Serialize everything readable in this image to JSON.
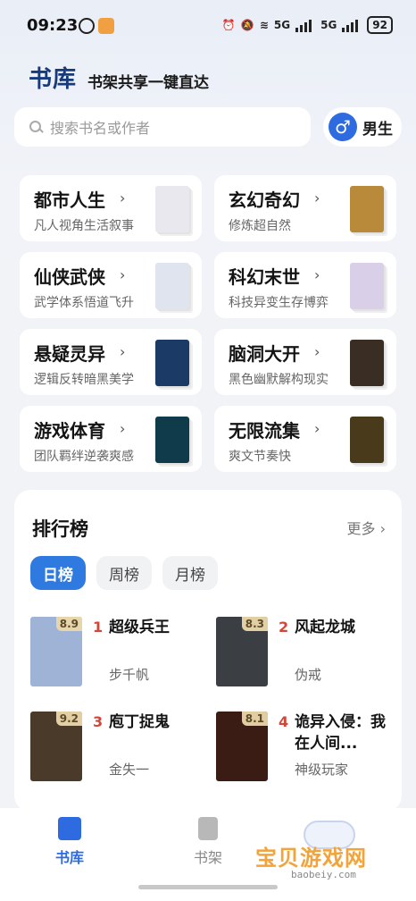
{
  "status_bar": {
    "time": "09:23",
    "net1": "5G",
    "net2": "5G",
    "battery": "92"
  },
  "header": {
    "title": "书库",
    "subtitle": "书架共享一键直达"
  },
  "search": {
    "placeholder": "搜索书名或作者"
  },
  "gender": {
    "icon": "male-symbol-icon",
    "label": "男生"
  },
  "categories": [
    {
      "name": "都市人生",
      "desc": "凡人视角生活叙事",
      "cover_color": "#e8e8ee"
    },
    {
      "name": "玄幻奇幻",
      "desc": "修炼超自然",
      "cover_color": "#b88a3a"
    },
    {
      "name": "仙侠武侠",
      "desc": "武学体系悟道飞升",
      "cover_color": "#dfe4ee"
    },
    {
      "name": "科幻末世",
      "desc": "科技异变生存博弈",
      "cover_color": "#d9cfe8"
    },
    {
      "name": "悬疑灵异",
      "desc": "逻辑反转暗黑美学",
      "cover_color": "#1b3a66"
    },
    {
      "name": "脑洞大开",
      "desc": "黑色幽默解构现实",
      "cover_color": "#3a2e24"
    },
    {
      "name": "游戏体育",
      "desc": "团队羁绊逆袭爽感",
      "cover_color": "#0f3b4a"
    },
    {
      "name": "无限流集",
      "desc": "爽文节奏快",
      "cover_color": "#4a3a1c"
    }
  ],
  "ranking": {
    "title": "排行榜",
    "more": "更多",
    "tabs": [
      "日榜",
      "周榜",
      "月榜"
    ],
    "active_tab": "日榜",
    "books": [
      {
        "rank": "1",
        "title": "超级兵王",
        "author": "步千帆",
        "score": "8.9",
        "cover_color": "#9fb3d6"
      },
      {
        "rank": "2",
        "title": "风起龙城",
        "author": "伪戒",
        "score": "8.3",
        "cover_color": "#3b3f44"
      },
      {
        "rank": "3",
        "title": "庖丁捉鬼",
        "author": "金失一",
        "score": "9.2",
        "cover_color": "#4a3a2a"
      },
      {
        "rank": "4",
        "title": "诡异入侵：我在人间...",
        "author": "神级玩家",
        "score": "8.1",
        "cover_color": "#3a1c14"
      }
    ]
  },
  "bottom_nav": [
    {
      "label": "书库",
      "icon": "library-book-icon",
      "active": true
    },
    {
      "label": "书架",
      "icon": "bookshelf-icon",
      "active": false
    }
  ],
  "watermark": {
    "logo": "宝贝游戏网",
    "url": "baobeiy.com"
  },
  "colors": {
    "accent": "#2f7ae0",
    "brand_title": "#173a7a",
    "rank_number": "#d0483a"
  }
}
